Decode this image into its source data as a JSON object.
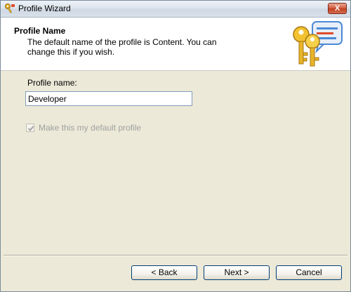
{
  "window": {
    "title": "Profile Wizard",
    "close_label": "X"
  },
  "header": {
    "title": "Profile Name",
    "description": "The default name of the profile is Content. You can change this if you wish."
  },
  "form": {
    "profile_name_label": "Profile name:",
    "profile_name_value": "Developer",
    "default_checkbox_label": "Make this my default profile",
    "default_checkbox_checked": true,
    "default_checkbox_disabled": true
  },
  "buttons": {
    "back": "< Back",
    "next": "Next >",
    "cancel": "Cancel"
  },
  "icons": {
    "title_icon": "keys-icon",
    "header_art": "keys-speech-bubble-icon",
    "close": "close-icon",
    "checkmark": "checkmark-icon"
  },
  "colors": {
    "accent_gold": "#e8b52a",
    "bubble_blue": "#4a8ad6",
    "close_red": "#c0401f"
  }
}
